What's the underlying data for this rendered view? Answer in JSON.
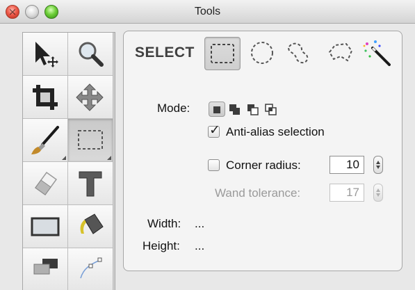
{
  "window": {
    "title": "Tools"
  },
  "toolbox": {
    "tools": [
      "pointer-tool",
      "magnifier-tool",
      "crop-tool",
      "move-tool",
      "brush-tool",
      "selection-tool",
      "eraser-tool",
      "text-tool",
      "rectangle-tool",
      "paint-bucket-tool",
      "shape-tool",
      "pen-tool"
    ],
    "selected": "selection-tool"
  },
  "options": {
    "header": "SELECT",
    "selection_shapes": [
      "rectangle-select-icon",
      "ellipse-select-icon",
      "lasso-select-icon",
      "polygon-lasso-icon",
      "magic-wand-icon"
    ],
    "active_shape": "rectangle-select-icon",
    "mode_label": "Mode:",
    "anti_alias": {
      "label": "Anti-alias selection",
      "checked": true
    },
    "corner_radius": {
      "label": "Corner radius:",
      "checked": false,
      "value": "10"
    },
    "wand_tolerance": {
      "label": "Wand tolerance:",
      "value": "17",
      "enabled": false
    },
    "width_label": "Width:",
    "width_value": "...",
    "height_label": "Height:",
    "height_value": "..."
  },
  "colors": {
    "close": "#ee5a4a",
    "minimize": "#dcdcdc",
    "zoom": "#6fcf3a",
    "panel": "#f4f4f4",
    "disabled_text": "#9a9a9a"
  }
}
